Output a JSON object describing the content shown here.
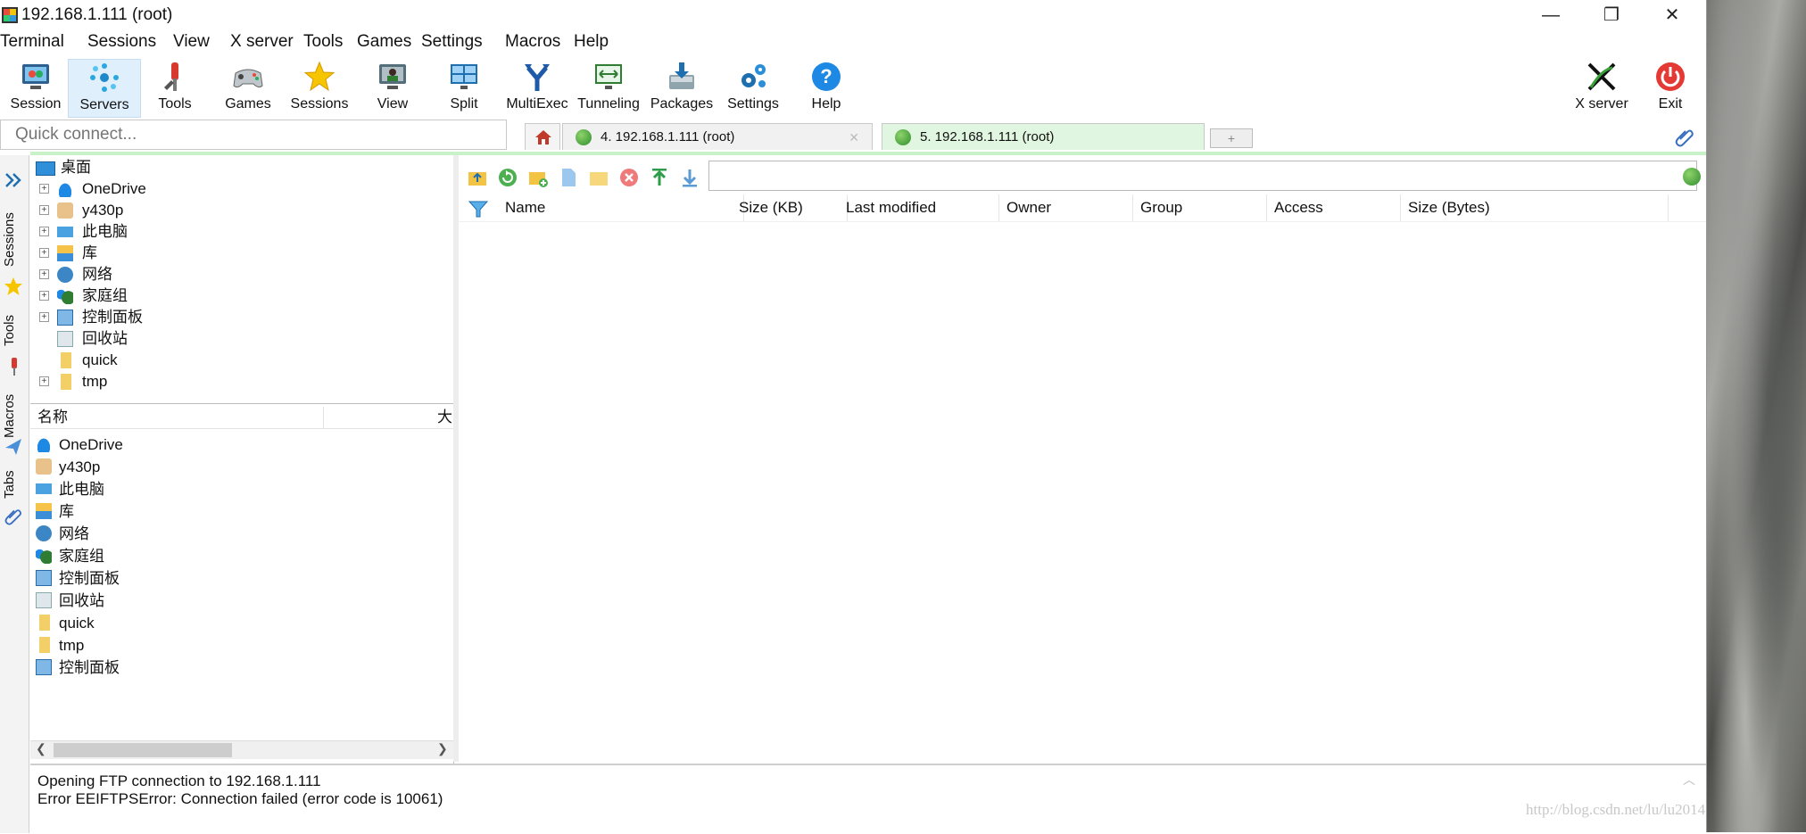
{
  "window": {
    "title": "192.168.1.111 (root)",
    "minimize": "—",
    "restore": "❐",
    "close": "✕"
  },
  "menu": [
    "Terminal",
    "Sessions",
    "View",
    "X server",
    "Tools",
    "Games",
    "Settings",
    "Macros",
    "Help"
  ],
  "toolbar": [
    {
      "label": "Session",
      "icon": "session-icon"
    },
    {
      "label": "Servers",
      "icon": "servers-icon"
    },
    {
      "label": "Tools",
      "icon": "tools-icon"
    },
    {
      "label": "Games",
      "icon": "gamepad-icon"
    },
    {
      "label": "Sessions",
      "icon": "star-icon"
    },
    {
      "label": "View",
      "icon": "view-icon"
    },
    {
      "label": "Split",
      "icon": "split-icon"
    },
    {
      "label": "MultiExec",
      "icon": "fork-icon"
    },
    {
      "label": "Tunneling",
      "icon": "tunneling-icon"
    },
    {
      "label": "Packages",
      "icon": "packages-icon"
    },
    {
      "label": "Settings",
      "icon": "gears-icon"
    },
    {
      "label": "Help",
      "icon": "help-icon"
    }
  ],
  "toolbar_right": [
    {
      "label": "X server",
      "icon": "x-server-icon"
    },
    {
      "label": "Exit",
      "icon": "power-icon"
    }
  ],
  "quick_connect": {
    "placeholder": "Quick connect..."
  },
  "tabs": [
    {
      "label": "4. 192.168.1.111 (root)",
      "active": false
    },
    {
      "label": "5. 192.168.1.111 (root)",
      "active": true
    }
  ],
  "side_tabs": [
    "Sessions",
    "Tools",
    "Macros",
    "Tabs"
  ],
  "tree": {
    "root": "桌面",
    "items": [
      {
        "label": "OneDrive",
        "expandable": true
      },
      {
        "label": "y430p",
        "expandable": true
      },
      {
        "label": "此电脑",
        "expandable": true
      },
      {
        "label": "库",
        "expandable": true
      },
      {
        "label": "网络",
        "expandable": true
      },
      {
        "label": "家庭组",
        "expandable": true
      },
      {
        "label": "控制面板",
        "expandable": true
      },
      {
        "label": "回收站",
        "expandable": false
      },
      {
        "label": "quick",
        "expandable": false
      },
      {
        "label": "tmp",
        "expandable": true
      }
    ]
  },
  "list": {
    "headers": [
      "名称",
      "大"
    ],
    "items": [
      "OneDrive",
      "y430p",
      "此电脑",
      "库",
      "网络",
      "家庭组",
      "控制面板",
      "回收站",
      "quick",
      "tmp",
      "控制面板"
    ]
  },
  "ftp": {
    "path": "",
    "columns": [
      "Name",
      "Size (KB)",
      "Last modified",
      "Owner",
      "Group",
      "Access",
      "Size (Bytes)"
    ]
  },
  "status": {
    "lines": [
      "Opening FTP connection to 192.168.1.111",
      "Error EEIFTPSError: Connection failed (error code is 10061)"
    ]
  },
  "watermark": "http://blog.csdn.net/lu/lu2014"
}
